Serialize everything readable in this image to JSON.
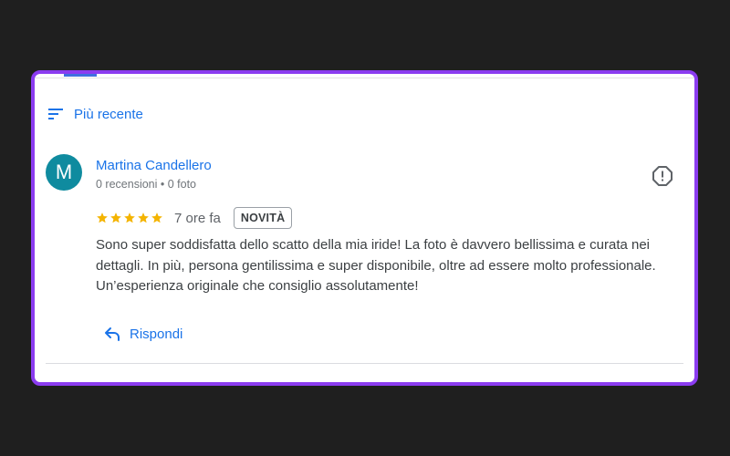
{
  "sort": {
    "label": "Più recente",
    "icon": "sort-icon"
  },
  "review": {
    "author": {
      "initial": "M",
      "name": "Martina Candellero",
      "meta": "0 recensioni • 0 foto",
      "avatar_color": "#0f8b9f"
    },
    "rating": 5,
    "max_rating": 5,
    "time": "7 ore fa",
    "badge": "NOVITÀ",
    "text": "Sono super soddisfatta dello scatto della mia iride! La foto è davvero bellissima e curata nei dettagli. In più, persona gentilissima e super disponibile, oltre ad essere molto professionale. Un’esperienza originale che consiglio assolutamente!"
  },
  "actions": {
    "reply_label": "Rispondi",
    "report_icon": "report-icon",
    "reply_icon": "reply-icon"
  },
  "colors": {
    "accent": "#1a73e8",
    "frame": "#8b3cf0",
    "star": "#f4b400",
    "background": "#1f1f1f"
  }
}
